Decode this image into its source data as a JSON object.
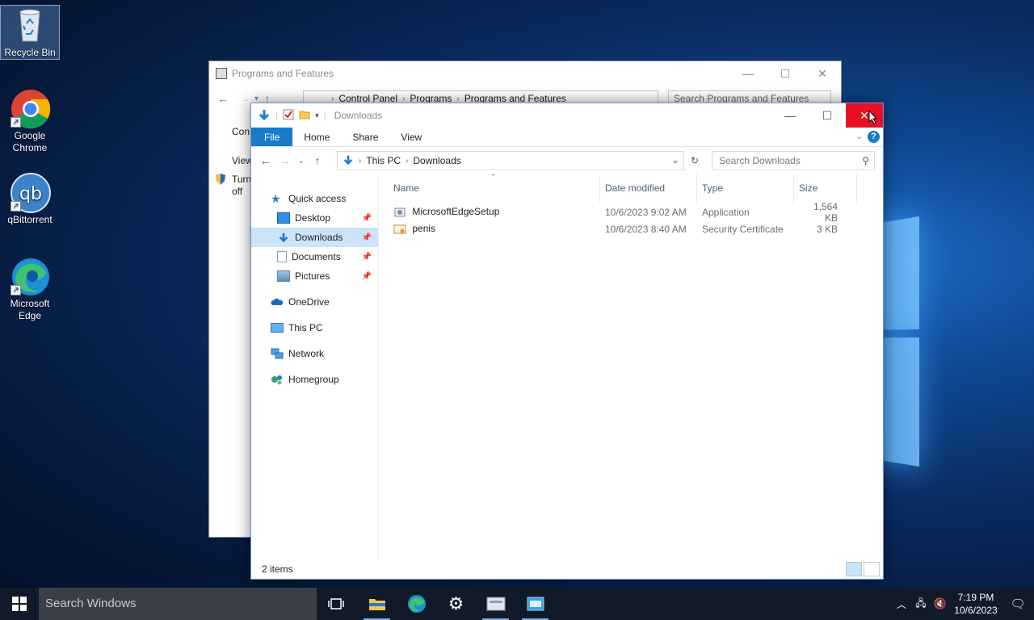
{
  "desktop": {
    "icons": [
      {
        "label": "Recycle Bin"
      },
      {
        "label": "Google Chrome"
      },
      {
        "label": "qBittorrent"
      },
      {
        "label": "Microsoft Edge"
      }
    ]
  },
  "back_window": {
    "title": "Programs and Features",
    "crumbs": [
      "Control Panel",
      "Programs",
      "Programs and Features"
    ],
    "search_placeholder": "Search Programs and Features",
    "side_items": [
      "Con",
      "View",
      "Turn",
      "off"
    ]
  },
  "explorer": {
    "title": "Downloads",
    "tabs": [
      "File",
      "Home",
      "Share",
      "View"
    ],
    "path": [
      "This PC",
      "Downloads"
    ],
    "search_placeholder": "Search Downloads",
    "nav": {
      "quick_access": "Quick access",
      "pinned": [
        "Desktop",
        "Downloads",
        "Documents",
        "Pictures"
      ],
      "onedrive": "OneDrive",
      "thispc": "This PC",
      "network": "Network",
      "homegroup": "Homegroup"
    },
    "columns": [
      "Name",
      "Date modified",
      "Type",
      "Size"
    ],
    "files": [
      {
        "name": "MicrosoftEdgeSetup",
        "date": "10/6/2023 9:02 AM",
        "type": "Application",
        "size": "1,564 KB"
      },
      {
        "name": "penis",
        "date": "10/6/2023 8:40 AM",
        "type": "Security Certificate",
        "size": "3 KB"
      }
    ],
    "status": "2 items"
  },
  "taskbar": {
    "search_placeholder": "Search Windows",
    "time": "7:19 PM",
    "date": "10/6/2023"
  }
}
